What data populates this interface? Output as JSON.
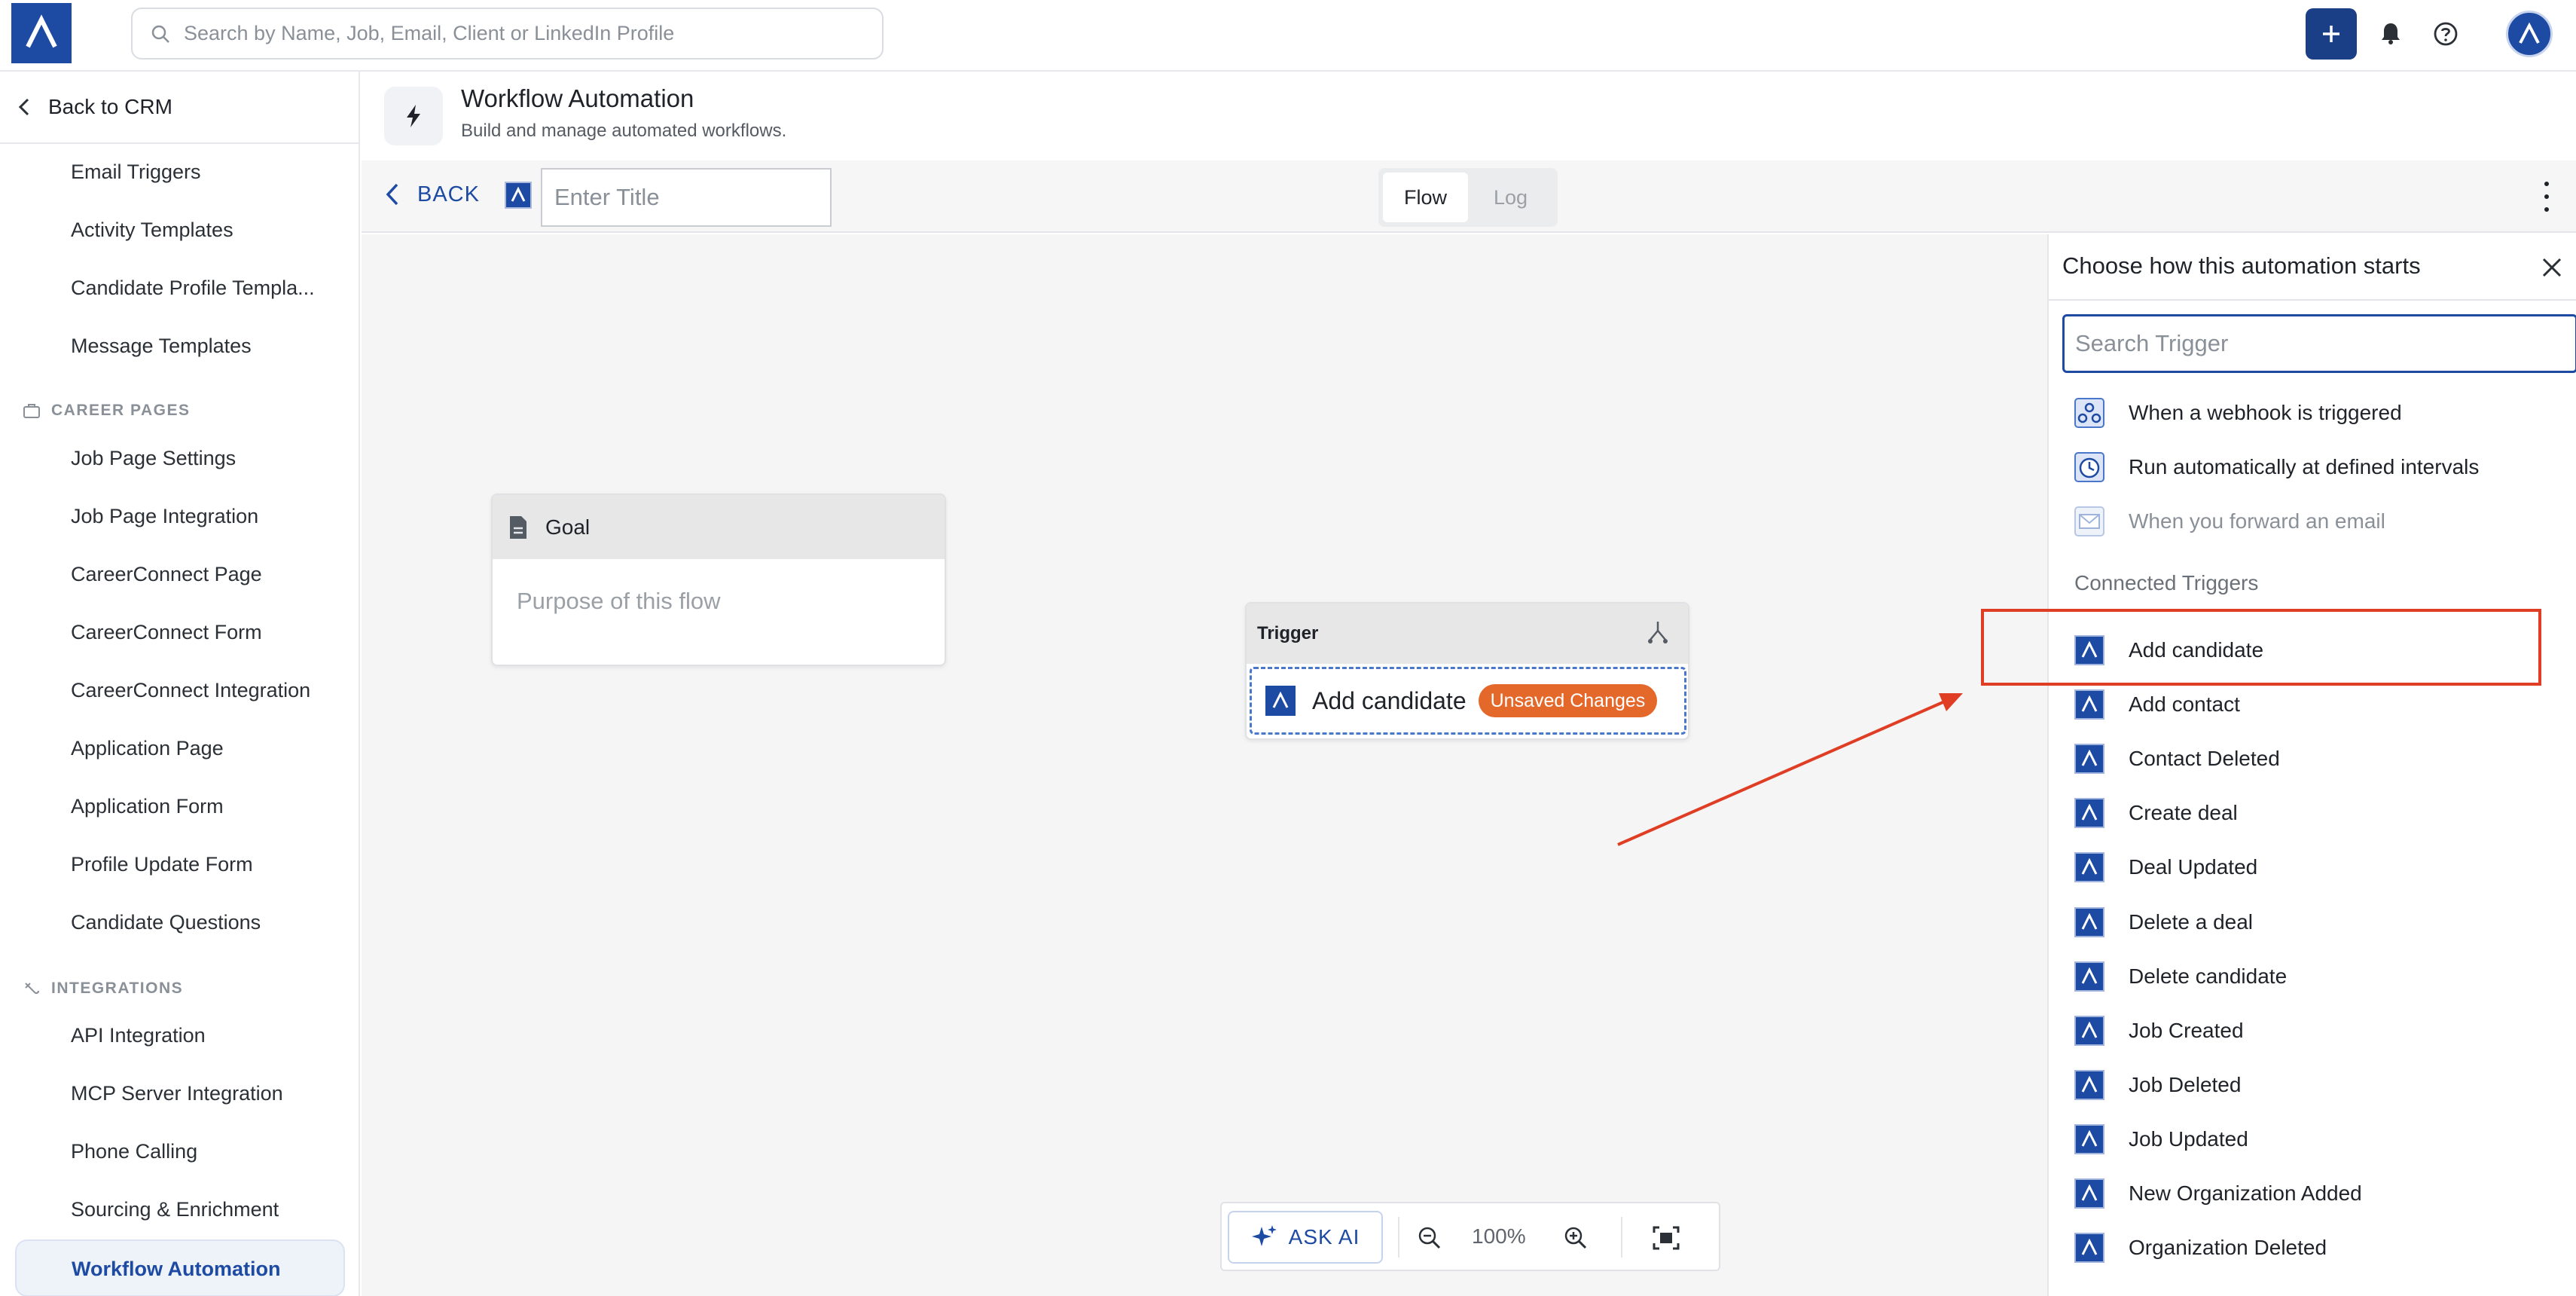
{
  "topbar": {
    "search_placeholder": "Search by Name, Job, Email, Client or LinkedIn Profile",
    "icons": [
      "app-logo",
      "search-icon",
      "plus-icon",
      "bell-icon",
      "help-icon",
      "avatar"
    ]
  },
  "sidebar": {
    "back_label": "Back to CRM",
    "items_top": [
      "Email Triggers",
      "Activity Templates",
      "Candidate Profile Templa...",
      "Message Templates"
    ],
    "section_career": "CAREER PAGES",
    "items_career": [
      "Job Page Settings",
      "Job Page Integration",
      "CareerConnect Page",
      "CareerConnect Form",
      "CareerConnect Integration",
      "Application Page",
      "Application Form",
      "Profile Update Form",
      "Candidate Questions"
    ],
    "section_integrations": "INTEGRATIONS",
    "items_integrations": [
      "API Integration",
      "MCP Server Integration",
      "Phone Calling",
      "Sourcing & Enrichment"
    ],
    "active_item": "Workflow Automation"
  },
  "page": {
    "title": "Workflow Automation",
    "subtitle": "Build and manage automated workflows."
  },
  "toolbar": {
    "back_label": "BACK",
    "title_placeholder": "Enter Title",
    "title_value": "",
    "tabs": [
      "Flow",
      "Log"
    ],
    "active_tab": "Flow"
  },
  "canvas": {
    "goal": {
      "title": "Goal",
      "placeholder": "Purpose of this flow"
    },
    "trigger": {
      "header": "Trigger",
      "name": "Add candidate",
      "badge": "Unsaved Changes"
    },
    "zoom": {
      "ask_ai": "ASK AI",
      "level": "100%"
    }
  },
  "panel": {
    "title": "Choose how this automation starts",
    "search_placeholder": "Search Trigger",
    "general_triggers": [
      {
        "label": "When a webhook is triggered",
        "icon": "webhook-icon",
        "disabled": false
      },
      {
        "label": "Run automatically at defined intervals",
        "icon": "clock-icon",
        "disabled": false
      },
      {
        "label": "When you forward an email",
        "icon": "mail-icon",
        "disabled": true
      }
    ],
    "connected_title": "Connected Triggers",
    "connected_triggers": [
      "Add candidate",
      "Add contact",
      "Contact Deleted",
      "Create deal",
      "Deal Updated",
      "Delete a deal",
      "Delete candidate",
      "Job Created",
      "Job Deleted",
      "Job Updated",
      "New Organization Added",
      "Organization Deleted"
    ],
    "highlighted_trigger": "Add candidate"
  },
  "colors": {
    "brand": "#1d4aa3",
    "badge": "#e5682b",
    "annotation": "#e03e24"
  }
}
